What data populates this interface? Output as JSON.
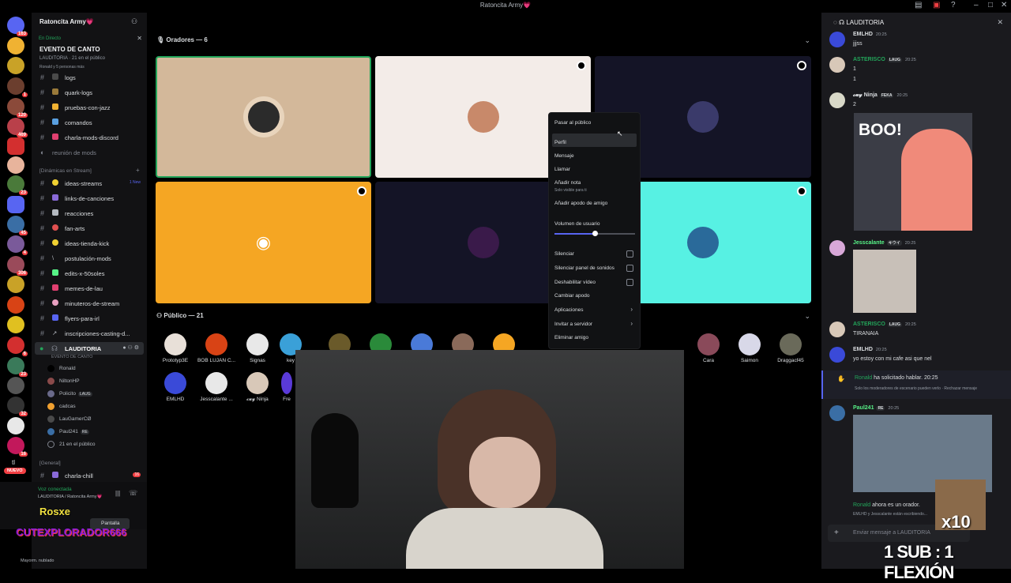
{
  "window": {
    "title": "Ratoncita Army💗"
  },
  "server": {
    "name": "Ratoncita Army💗"
  },
  "event": {
    "live_label": "En Directo",
    "name": "EVENTO DE CANTO",
    "sub": "LAUDITORIA · 21 en el público",
    "sub2": "Ronald y 5 personas más"
  },
  "channels_top": [
    {
      "label": "logs",
      "muted": false
    },
    {
      "label": "quark-logs",
      "muted": false
    },
    {
      "label": "pruebas-con-jazz",
      "muted": false
    },
    {
      "label": "comandos",
      "muted": false
    },
    {
      "label": "charla-mods-discord",
      "muted": false
    },
    {
      "label": "reunión de mods",
      "muted": true
    }
  ],
  "category_dyn": "[Dinámicas en Stream]",
  "channels_dyn": [
    {
      "label": "ideas-streams",
      "badge": "1 New"
    },
    {
      "label": "links-de-canciones",
      "badge": ""
    },
    {
      "label": "reacciones",
      "badge": ""
    },
    {
      "label": "fan-arts",
      "badge": ""
    },
    {
      "label": "ideas-tienda-kick",
      "badge": ""
    },
    {
      "label": "postulación-mods",
      "badge": ""
    },
    {
      "label": "edits-x-50soles",
      "badge": ""
    },
    {
      "label": "memes-de-lau",
      "badge": ""
    },
    {
      "label": "minuteros-de-stream",
      "badge": ""
    },
    {
      "label": "flyers-para-irl",
      "badge": ""
    },
    {
      "label": "inscripciones-casting-d...",
      "badge": ""
    }
  ],
  "stage_channel": {
    "label": "LAUDITORIA",
    "sub": "EVENTO DE CANTO"
  },
  "stage_users": [
    "Ronald",
    "NiltonHP",
    "Policito",
    "cadcas",
    "LauGamerCØ",
    "Paul241"
  ],
  "stage_audience": "21 en el público",
  "category_general": "[General]",
  "channel_general": {
    "label": "charla-chill",
    "badge": "16"
  },
  "new_badge": "NUEVO",
  "voice": {
    "status": "Voz conectada",
    "channel": "LAUDITORIA / Ratoncita Army💗",
    "screen": "Pantalla"
  },
  "stream_overlay": {
    "name1": "Rosxe",
    "name2": "CUTEXPLORADOR666",
    "user3": "Mayorm. nublado"
  },
  "speakers": {
    "header": "Oradores — 6"
  },
  "audience": {
    "header": "Público — 21",
    "row1": [
      "Prototyp3E",
      "BOB LUJAN C...",
      "Signas",
      "key",
      "",
      "",
      "",
      "",
      "",
      "",
      "",
      "Cara",
      "Saimon",
      "Draggacf45"
    ],
    "row2": [
      "EMLHD",
      "Jesscalante ...",
      "𝓬𝓾𝔂 Ninja",
      "Fre"
    ]
  },
  "context_menu": {
    "items": [
      "Pasar al público",
      "Perfil",
      "Mensaje",
      "Llamar",
      "Añadir nota",
      "Añadir apodo de amigo",
      "Volumen de usuario",
      "Silenciar",
      "Silenciar panel de sonidos",
      "Deshabilitar vídeo",
      "Cambiar apodo",
      "Aplicaciones",
      "Invitar a servidor",
      "Eliminar amigo"
    ],
    "note_sub": "Solo visible para ti",
    "volume": 0.5
  },
  "chat": {
    "header": "LAUDITORIA",
    "messages": [
      {
        "user": "EMLHD",
        "time": "20:25",
        "text": "jjjss",
        "color": "#dbdee1"
      },
      {
        "user": "ASTERISCO",
        "tag": "LAUG",
        "time": "20:25",
        "text": "1",
        "text2": "1",
        "color": "#23a55a"
      },
      {
        "user": "𝓬𝓾𝔂 Ninja",
        "tag": "FEKA",
        "time": "20:25",
        "text": "2",
        "color": "#dbdee1"
      },
      {
        "user": "Jesscalante",
        "tag": "キウイ",
        "time": "20:25",
        "text": "",
        "color": "#57f287"
      },
      {
        "user": "ASTERISCO",
        "tag": "LAUG",
        "time": "20:25",
        "text": "TIRANAIA",
        "color": "#23a55a"
      },
      {
        "user": "EMLHD",
        "time": "20:25",
        "text": "yo estoy con mi cafe asi que nel",
        "color": "#dbdee1"
      },
      {
        "user": "Ronald",
        "time": "20:25",
        "text": "ha solicitado hablar.",
        "sub": "Solo los moderadores de escenario pueden verlo · Rechazar mensaje",
        "color": "#23a55a"
      },
      {
        "user": "Paul241",
        "tag": "RE",
        "time": "20:25",
        "text": "",
        "color": "#57f287"
      },
      {
        "user": "Ronald",
        "time": "",
        "text": "ahora es un orador.",
        "sub": "EMLHD y Jesscalante están escribiendo...",
        "color": "#23a55a"
      }
    ],
    "boo_text": "BOO!",
    "input_placeholder": "Enviar mensaje a LAUDITORIA"
  },
  "overlay": {
    "x10": "x10",
    "sub_text": "1 SUB : 1 FLEXIÓN"
  }
}
